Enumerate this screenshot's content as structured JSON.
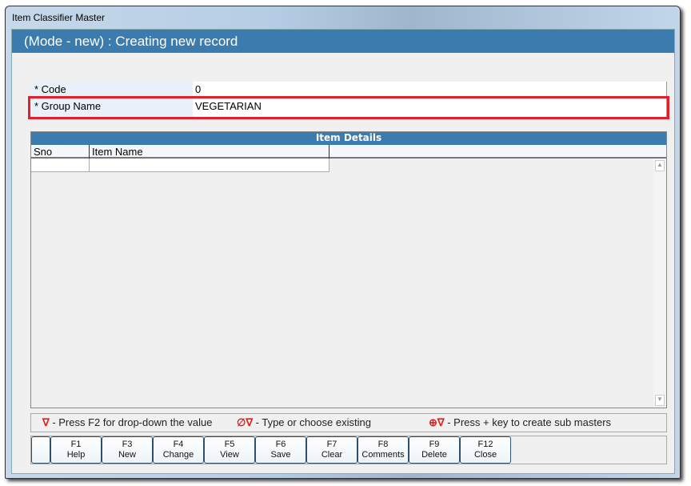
{
  "window": {
    "title": "Item Classifier Master"
  },
  "header": {
    "title": "(Mode - new) : Creating new record"
  },
  "form": {
    "code_label": "* Code",
    "code_value": "0",
    "group_label": "* Group Name",
    "group_value": "VEGETARIAN"
  },
  "grid": {
    "title": "Item Details",
    "columns": [
      "Sno",
      "Item Name"
    ]
  },
  "legend": [
    {
      "icon": "∇",
      "text": " - Press F2 for drop-down the value"
    },
    {
      "icon": "∅∇",
      "text": " - Type or choose existing"
    },
    {
      "icon": "⊕∇",
      "text": " - Press + key to create sub masters"
    }
  ],
  "buttons": [
    {
      "key": "F1",
      "label": "Help"
    },
    {
      "key": "F3",
      "label": "New"
    },
    {
      "key": "F4",
      "label": "Change"
    },
    {
      "key": "F5",
      "label": "View"
    },
    {
      "key": "F6",
      "label": "Save"
    },
    {
      "key": "F7",
      "label": "Clear"
    },
    {
      "key": "F8",
      "label": "Comments"
    },
    {
      "key": "F9",
      "label": "Delete"
    },
    {
      "key": "F12",
      "label": "Close"
    }
  ]
}
